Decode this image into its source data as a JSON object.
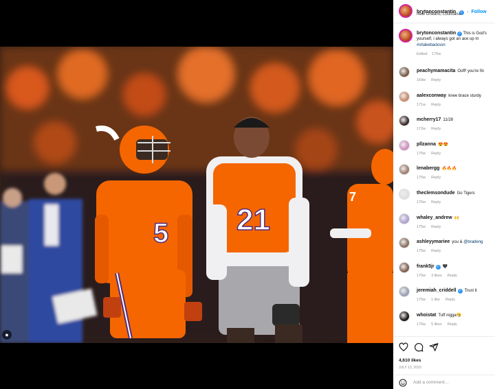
{
  "post": {
    "author": "brytonconstantin",
    "follow_label": "Follow",
    "location": "New Orleans, Louisiana",
    "caption_author": "brytonconstantin",
    "caption_text": "This is God's",
    "caption_text_2": "yourself, i always got an ace up m",
    "caption_hashtag": "#shakebackson",
    "caption_edited": "Edited",
    "caption_time": "175w"
  },
  "comments": [
    {
      "user": "peachymamacita",
      "text": "Ooff! you're fin",
      "time": "169w",
      "likes": "",
      "reply": "Reply",
      "verified": false
    },
    {
      "user": "aalexconway",
      "text": "knee brace sturdy",
      "time": "171w",
      "likes": "",
      "reply": "Reply",
      "verified": false
    },
    {
      "user": "mcherry17",
      "text": "11/28",
      "time": "172w",
      "likes": "",
      "reply": "Reply",
      "verified": false
    },
    {
      "user": "pllzanna",
      "text": "😍😍",
      "time": "175w",
      "likes": "",
      "reply": "Reply",
      "verified": false
    },
    {
      "user": "lenabergg",
      "text": "🔥🔥🔥",
      "time": "175w",
      "likes": "",
      "reply": "Reply",
      "verified": false
    },
    {
      "user": "theclemsondude",
      "text": "Go Tigers",
      "time": "175w",
      "likes": "",
      "reply": "Reply",
      "verified": false
    },
    {
      "user": "whaley_andrew",
      "text": "🙌",
      "time": "175w",
      "likes": "",
      "reply": "Reply",
      "verified": false
    },
    {
      "user": "ashleyymariee",
      "text": "you & ",
      "mention": "@bradeng",
      "time": "175w",
      "likes": "",
      "reply": "Reply",
      "verified": false
    },
    {
      "user": "frank5jr",
      "text": "🖤",
      "time": "175w",
      "likes": "3 likes",
      "reply": "Reply",
      "verified": true
    },
    {
      "user": "jeremiah_criddell",
      "text": "Trust it",
      "time": "175w",
      "likes": "1 like",
      "reply": "Reply",
      "verified": true
    },
    {
      "user": "whoistat",
      "text": "Tuff nigga🤧",
      "time": "175w",
      "likes": "5 likes",
      "reply": "Reply",
      "verified": false
    }
  ],
  "actions": {
    "likes": "4,610 likes",
    "date": "JULY 13, 2020",
    "add_comment_placeholder": "Add a comment…"
  },
  "icons": {
    "like": "heart-icon",
    "comment": "comment-icon",
    "share": "share-icon",
    "emoji": "emoji-icon",
    "media_user": "user-tag-icon"
  },
  "colors": {
    "clemson_orange": "#f56600",
    "regalia_purple": "#522d80",
    "link_blue": "#0095f6",
    "verified_blue": "#3897f0"
  }
}
